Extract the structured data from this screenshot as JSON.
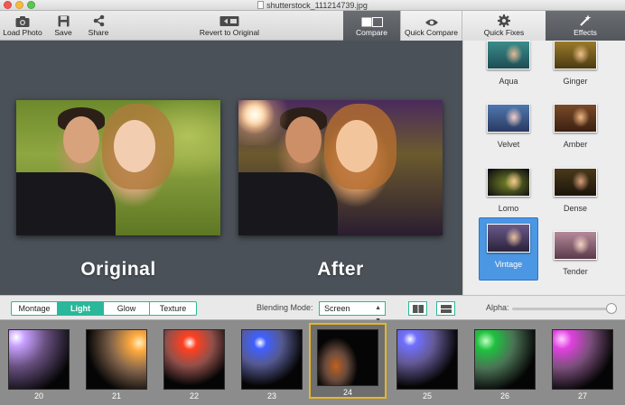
{
  "window": {
    "title": "shutterstock_111214739.jpg"
  },
  "toolbar": {
    "load_photo": "Load Photo",
    "save": "Save",
    "share": "Share",
    "revert": "Revert to Original",
    "compare": "Compare",
    "quick_compare": "Quick Compare",
    "quick_fixes": "Quick Fixes",
    "effects": "Effects"
  },
  "preview": {
    "original_label": "Original",
    "after_label": "After"
  },
  "effects_panel": {
    "items": [
      {
        "name": "Aqua"
      },
      {
        "name": "Ginger"
      },
      {
        "name": "Velvet"
      },
      {
        "name": "Amber"
      },
      {
        "name": "Lomo"
      },
      {
        "name": "Dense"
      },
      {
        "name": "Vintage",
        "selected": true
      },
      {
        "name": "Tender"
      }
    ]
  },
  "blend_bar": {
    "tabs": [
      "Montage",
      "Light",
      "Glow",
      "Texture"
    ],
    "active_tab": "Light",
    "blending_mode_label": "Blending Mode:",
    "blending_mode_value": "Screen",
    "alpha_label": "Alpha:",
    "alpha_value": 1.0
  },
  "filmstrip": {
    "items": [
      "20",
      "21",
      "22",
      "23",
      "24",
      "25",
      "26",
      "27"
    ],
    "selected": "24"
  },
  "colors": {
    "accent": "#2bb89a",
    "selection_blue": "#4c97e3",
    "film_highlight": "#e6b628",
    "preview_bg": "#4b5158"
  }
}
